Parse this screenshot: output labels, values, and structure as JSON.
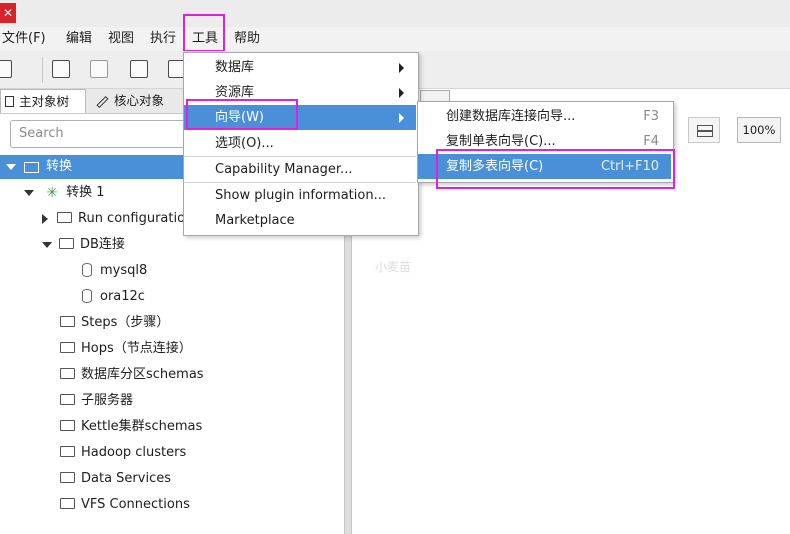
{
  "app": {
    "icon_glyph": "✕"
  },
  "menubar": [
    {
      "label": "文件(F)"
    },
    {
      "label": "编辑"
    },
    {
      "label": "视图"
    },
    {
      "label": "执行"
    },
    {
      "label": "工具"
    },
    {
      "label": "帮助"
    }
  ],
  "left_panel": {
    "tabs": [
      {
        "label": "主对象树"
      },
      {
        "label": "核心对象"
      }
    ],
    "search_placeholder": "Search",
    "tree": {
      "root": "转换",
      "transform": "转换 1",
      "items": [
        {
          "label": "Run configuratio"
        },
        {
          "label": "DB连接"
        },
        {
          "label": "mysql8"
        },
        {
          "label": "ora12c"
        },
        {
          "label": "Steps（步骤）"
        },
        {
          "label": "Hops（节点连接）"
        },
        {
          "label": "数据库分区schemas"
        },
        {
          "label": "子服务器"
        },
        {
          "label": "Kettle集群schemas"
        },
        {
          "label": "Hadoop clusters"
        },
        {
          "label": "Data Services"
        },
        {
          "label": "VFS Connections"
        }
      ]
    }
  },
  "canvas": {
    "zoom": "100%",
    "watermark": "小麦苗"
  },
  "tools_menu": {
    "items": [
      {
        "label": "数据库"
      },
      {
        "label": "资源库"
      },
      {
        "label": "向导(W)"
      },
      {
        "label": "选项(O)..."
      },
      {
        "label": "Capability Manager..."
      },
      {
        "label": "Show plugin information..."
      },
      {
        "label": "Marketplace"
      }
    ]
  },
  "wizard_submenu": {
    "items": [
      {
        "label": "创建数据库连接向导...",
        "shortcut": "F3"
      },
      {
        "label": "复制单表向导(C)...",
        "shortcut": "F4"
      },
      {
        "label": "复制多表向导(C)",
        "shortcut": "Ctrl+F10"
      }
    ]
  },
  "colors": {
    "selection": "#4a90d9",
    "highlight_box": "#e020e0",
    "app_icon": "#d8232a"
  }
}
